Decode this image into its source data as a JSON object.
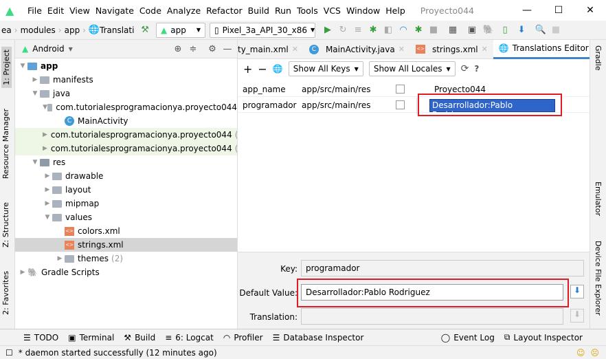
{
  "title": {
    "menu": [
      "File",
      "Edit",
      "View",
      "Navigate",
      "Code",
      "Analyze",
      "Refactor",
      "Build",
      "Run",
      "Tools",
      "VCS",
      "Window",
      "Help"
    ],
    "project": "Proyecto044"
  },
  "nav": {
    "crumbs": [
      "ea",
      "modules",
      "app",
      "Translatic"
    ],
    "run_config": "app",
    "device": "Pixel_3a_API_30_x86"
  },
  "left_tabs": [
    "1: Project",
    "Resource Manager",
    "Z: Structure",
    "2: Favorites"
  ],
  "right_tabs": [
    "Gradle",
    "Emulator",
    "Device File Explorer"
  ],
  "project": {
    "view": "Android",
    "tree": [
      {
        "label": "app",
        "level": 0,
        "icon": "module",
        "arrow": "down",
        "bold": true
      },
      {
        "label": "manifests",
        "level": 1,
        "icon": "folder",
        "arrow": "right"
      },
      {
        "label": "java",
        "level": 1,
        "icon": "folder",
        "arrow": "down"
      },
      {
        "label": "com.tutorialesprogramacionya.proyecto044",
        "level": 2,
        "icon": "package",
        "arrow": "down"
      },
      {
        "label": "MainActivity",
        "level": 3,
        "icon": "class"
      },
      {
        "label": "com.tutorialesprogramacionya.proyecto044",
        "suffix": "(ar",
        "level": 2,
        "icon": "package",
        "arrow": "right",
        "green": true
      },
      {
        "label": "com.tutorialesprogramacionya.proyecto044",
        "suffix": "(te",
        "level": 2,
        "icon": "package",
        "arrow": "right",
        "green": true
      },
      {
        "label": "res",
        "level": 1,
        "icon": "res",
        "arrow": "down"
      },
      {
        "label": "drawable",
        "level": 2,
        "icon": "folder",
        "arrow": "right"
      },
      {
        "label": "layout",
        "level": 2,
        "icon": "folder",
        "arrow": "right"
      },
      {
        "label": "mipmap",
        "level": 2,
        "icon": "folder",
        "arrow": "right"
      },
      {
        "label": "values",
        "level": 2,
        "icon": "folder",
        "arrow": "down"
      },
      {
        "label": "colors.xml",
        "level": 3,
        "icon": "xml"
      },
      {
        "label": "strings.xml",
        "level": 3,
        "icon": "xml",
        "selected": true
      },
      {
        "label": "themes",
        "suffix": "(2)",
        "level": 3,
        "icon": "folder",
        "arrow": "right"
      },
      {
        "label": "Gradle Scripts",
        "level": 0,
        "icon": "gradle",
        "arrow": "right"
      }
    ]
  },
  "tabs": [
    {
      "label": "ty_main.xml"
    },
    {
      "label": "MainActivity.java",
      "icon": "class"
    },
    {
      "label": "strings.xml",
      "icon": "xml"
    },
    {
      "label": "Translations Editor",
      "icon": "globe",
      "active": true
    }
  ],
  "translations": {
    "keys_filter": "Show All Keys",
    "locales_filter": "Show All Locales",
    "help": "?",
    "rows": [
      {
        "key": "app_name",
        "resource": "app/src/main/res",
        "untranslatable": false,
        "default": "Proyecto044"
      },
      {
        "key": "programador",
        "resource": "app/src/main/res",
        "untranslatable": false,
        "default": "Desarrollador:Pablo Rodriguez",
        "selected": true
      }
    ]
  },
  "detail": {
    "key_label": "Key:",
    "key_value": "programador",
    "default_label": "Default Value:",
    "default_value": "Desarrollador:Pablo Rodriguez",
    "translation_label": "Translation:",
    "translation_value": ""
  },
  "tool_windows": [
    "TODO",
    "Terminal",
    "Build",
    "6: Logcat",
    "Profiler",
    "Database Inspector"
  ],
  "tool_windows_right": [
    "Event Log",
    "Layout Inspector"
  ],
  "status": "* daemon started successfully (12 minutes ago)",
  "colors": {
    "accent": "#4083c9",
    "highlight": "#e01b24",
    "selection": "#2f65ca",
    "android_green": "#3ddc84"
  }
}
